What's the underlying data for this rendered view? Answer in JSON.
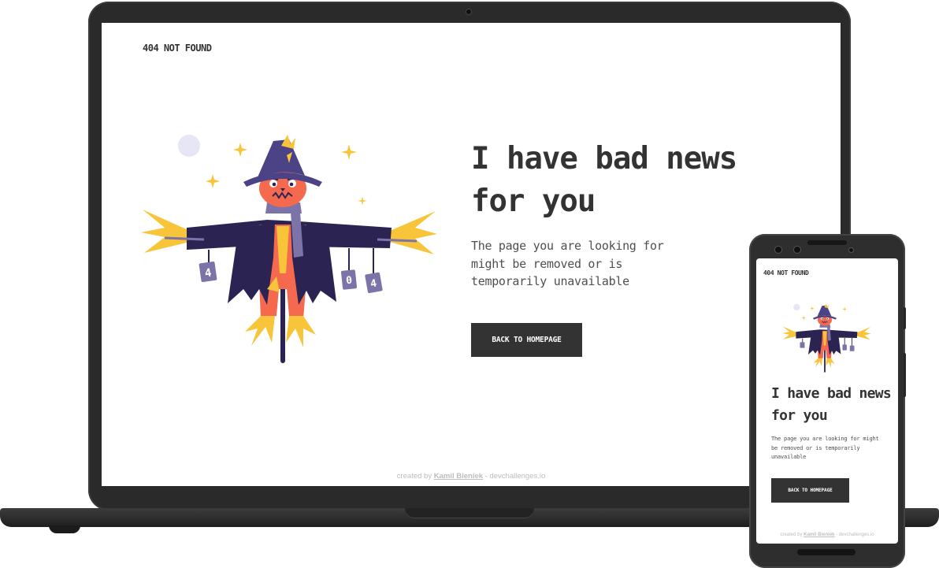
{
  "page": {
    "brand": "404 NOT FOUND",
    "heading": "I have bad news for you",
    "description": "The page you are looking for might be removed or is temporarily unavailable",
    "button_label": "BACK TO HOMEPAGE",
    "footer": {
      "prefix": "created by ",
      "author": "Kamil Bieniek",
      "separator": " - ",
      "site": "devchallenges.io"
    }
  },
  "illustration": {
    "subject": "scarecrow",
    "can_labels": [
      "4",
      "0",
      "4"
    ]
  },
  "colors": {
    "text_dark": "#333333",
    "text_body": "#4f4f4f",
    "button_bg": "#333333",
    "footer_text": "#bdbdbd",
    "hat": "#4b4385",
    "coat": "#2b2452",
    "face": "#f56a4f",
    "straw": "#f8c53a",
    "can": "#7c74a8",
    "moon": "#e6e6f5"
  }
}
